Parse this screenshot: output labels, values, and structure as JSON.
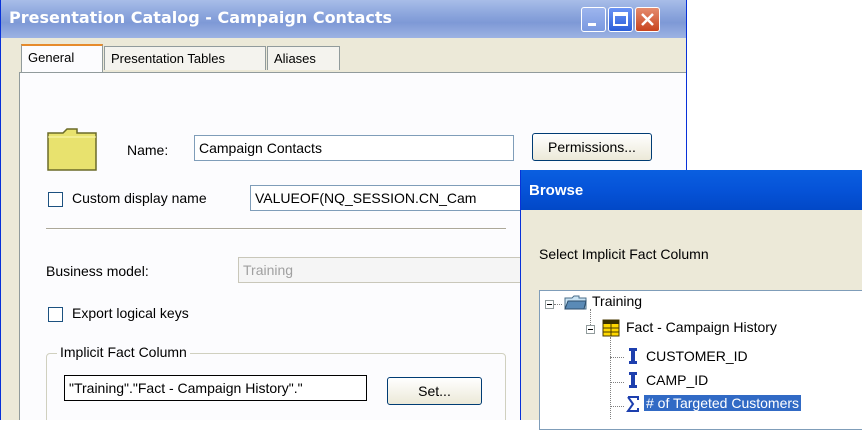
{
  "main_dialog": {
    "title": "Presentation Catalog - Campaign Contacts",
    "tabs": [
      {
        "label": "General",
        "active": true
      },
      {
        "label": "Presentation Tables",
        "active": false
      },
      {
        "label": "Aliases",
        "active": false
      }
    ],
    "name_label": "Name:",
    "name_value": "Campaign Contacts",
    "permissions_button": "Permissions...",
    "custom_display_name_label": "Custom display name",
    "custom_display_name_checked": false,
    "custom_display_name_value": "VALUEOF(NQ_SESSION.CN_Cam",
    "business_model_label": "Business model:",
    "business_model_value": "Training",
    "export_logical_keys_label": "Export logical keys",
    "export_logical_keys_checked": false,
    "implicit_fact_group_title": "Implicit Fact Column",
    "implicit_fact_value": "\"Training\".\"Fact - Campaign History\".\"",
    "set_button": "Set..."
  },
  "browse_dialog": {
    "title": "Browse",
    "prompt": "Select Implicit Fact Column",
    "tree": [
      {
        "label": "Training",
        "icon": "database-folder-icon",
        "level": 0
      },
      {
        "label": "Fact - Campaign History",
        "icon": "fact-table-icon",
        "level": 1
      },
      {
        "label": "CUSTOMER_ID",
        "icon": "column-icon",
        "level": 2
      },
      {
        "label": "CAMP_ID",
        "icon": "column-icon",
        "level": 2
      },
      {
        "label": "# of Targeted Customers",
        "icon": "measure-sum-icon",
        "level": 2,
        "selected": true
      }
    ]
  },
  "colors": {
    "dialog_bg": "#ece9d8",
    "selection": "#316ac5",
    "active_title": "#0653d8",
    "inactive_title": "#8aa4dc"
  }
}
